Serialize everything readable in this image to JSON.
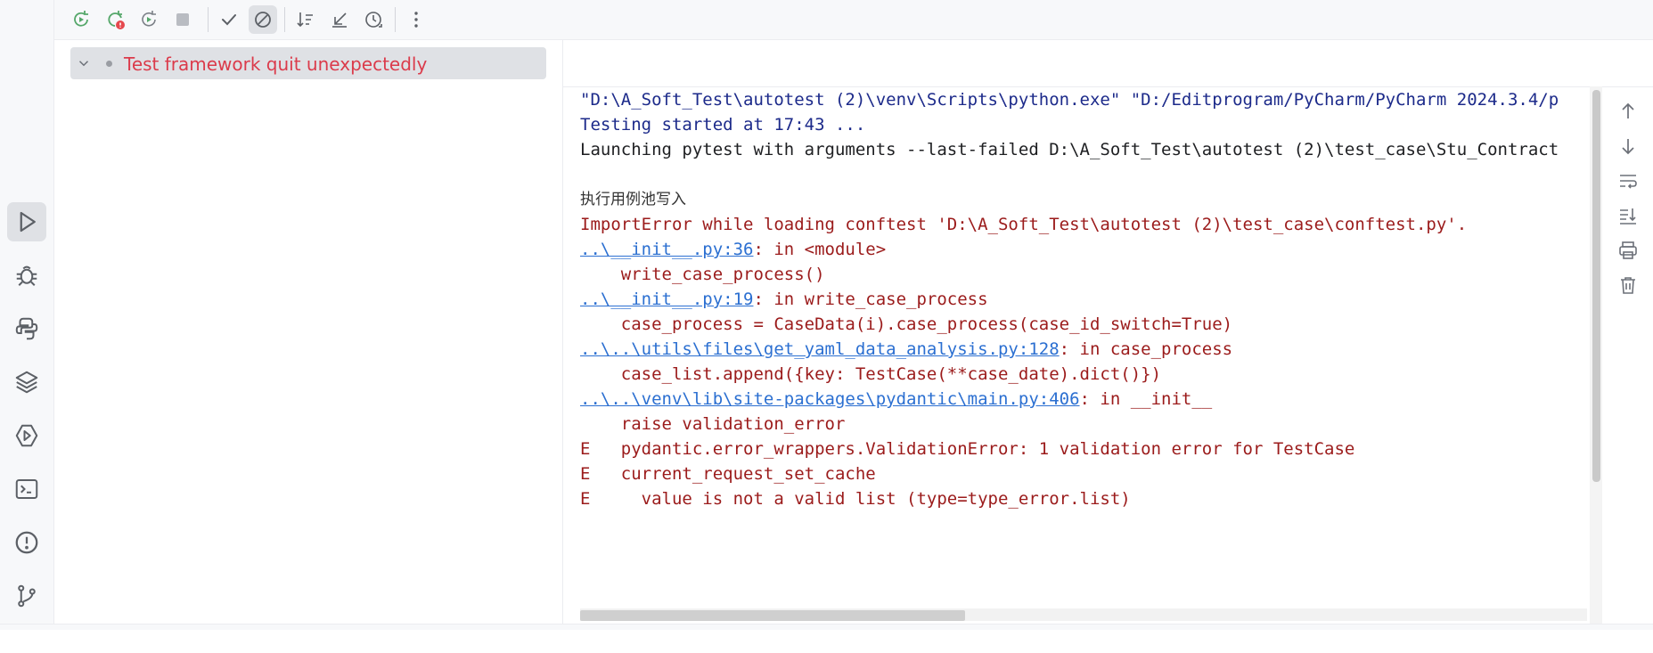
{
  "toolbar": {
    "buttons": [
      {
        "icon": "rerun-icon"
      },
      {
        "icon": "rerun-failed-icon"
      },
      {
        "icon": "toggle-auto-test-icon"
      },
      {
        "icon": "stop-icon"
      },
      {
        "icon": "show-passed-icon"
      },
      {
        "icon": "show-ignored-icon"
      },
      {
        "icon": "sort-icon"
      },
      {
        "icon": "collapse-all-icon"
      },
      {
        "icon": "history-icon"
      },
      {
        "icon": "more-options-icon"
      }
    ]
  },
  "left_strip": {
    "tools": [
      "run-icon",
      "debug-icon",
      "python-console-icon",
      "layers-icon",
      "services-icon",
      "terminal-icon",
      "problems-icon",
      "git-icon"
    ]
  },
  "tree": {
    "item_label": "Test framework quit unexpectedly"
  },
  "console": {
    "lines": [
      {
        "text": "\"D:\\A_Soft_Test\\autotest (2)\\venv\\Scripts\\python.exe\" \"D:/Editprogram/PyCharm/PyCharm 2024.3.4/p"
      },
      {
        "text": "Testing started at 17:43 ..."
      },
      {
        "text": "Launching pytest with arguments --last-failed D:\\A_Soft_Test\\autotest (2)\\test_case\\Stu_Contract"
      },
      {
        "text": "执行用例池写入"
      },
      {
        "text": "ImportError while loading conftest 'D:\\A_Soft_Test\\autotest (2)\\test_case\\conftest.py'."
      },
      {
        "link": "..\\__init__.py:36",
        "rest": ": in <module>"
      },
      {
        "text": "    write_case_process()"
      },
      {
        "link": "..\\__init__.py:19",
        "rest": ": in write_case_process"
      },
      {
        "text": "    case_process = CaseData(i).case_process(case_id_switch=True)"
      },
      {
        "link": "..\\..\\utils\\files\\get_yaml_data_analysis.py:128",
        "rest": ": in case_process"
      },
      {
        "text": "    case_list.append({key: TestCase(**case_date).dict()})"
      },
      {
        "link": "..\\..\\venv\\lib\\site-packages\\pydantic\\main.py:406",
        "rest": ": in __init__"
      },
      {
        "text": "    raise validation_error"
      },
      {
        "text": "E   pydantic.error_wrappers.ValidationError: 1 validation error for TestCase"
      },
      {
        "text": "E   current_request_set_cache"
      },
      {
        "text": "E     value is not a valid list (type=type_error.list)"
      }
    ]
  },
  "colors": {
    "error_label": "#db3b4b",
    "console_blue": "#1c2a8a",
    "console_red": "#9b1b1b",
    "link": "#2b6fd1"
  }
}
